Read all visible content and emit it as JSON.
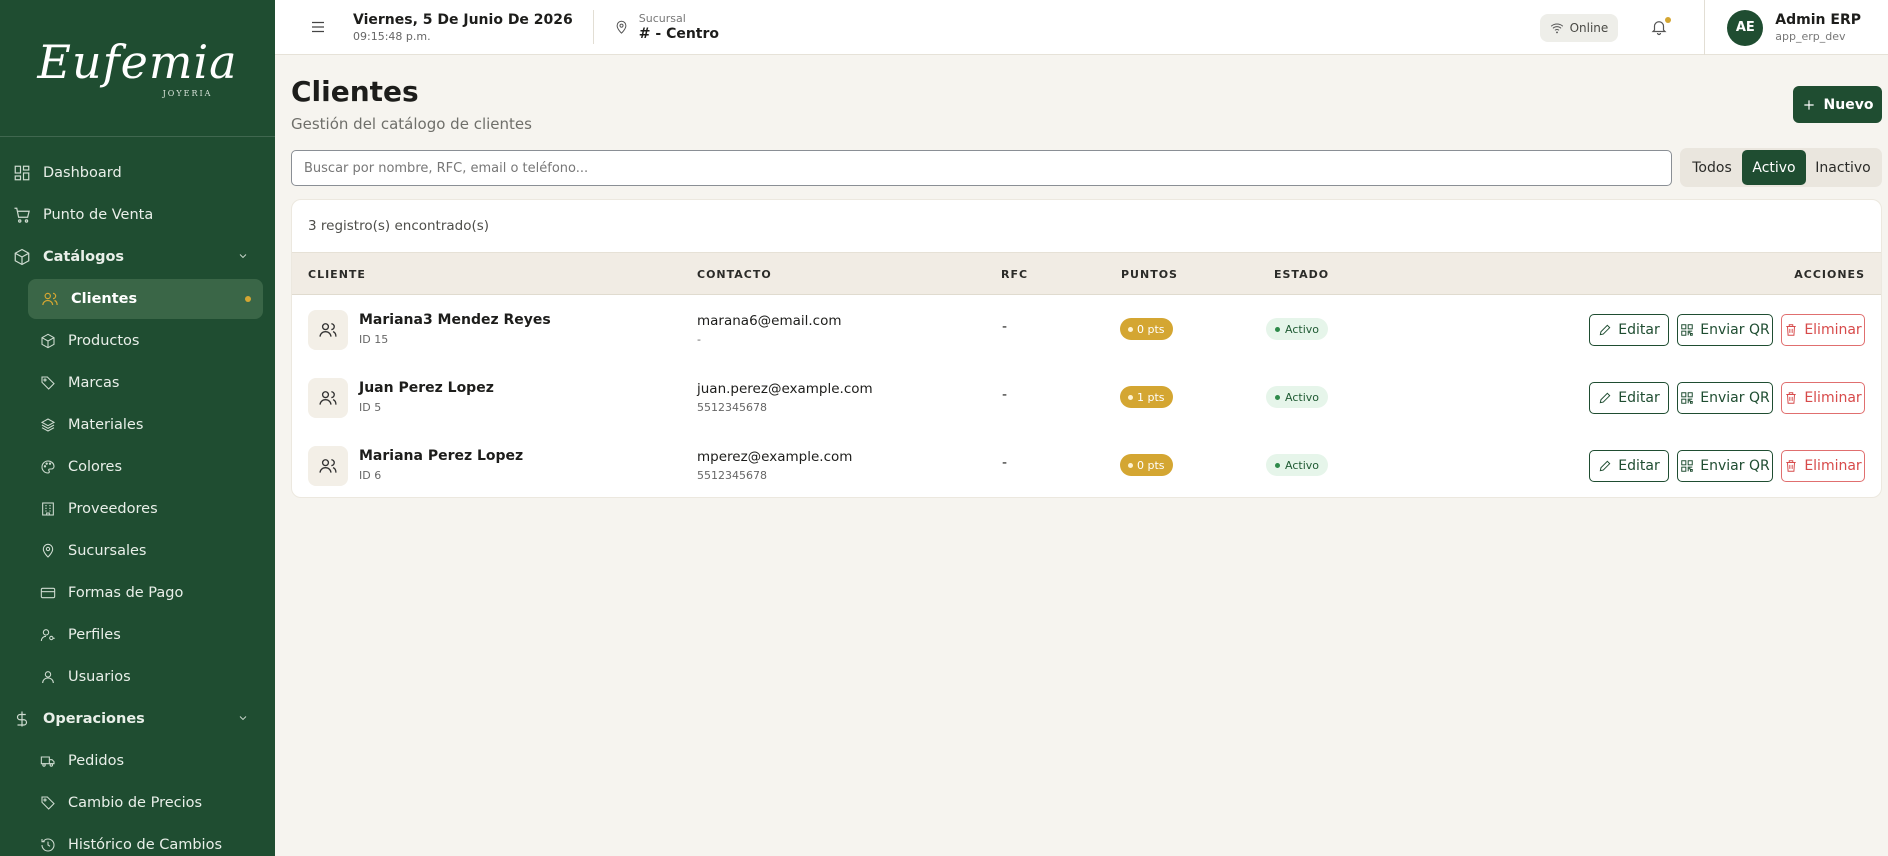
{
  "brand": {
    "name": "Eufemia",
    "subtitle": "JOYERIA"
  },
  "colors": {
    "primary": "#1f4d31",
    "accent": "#d4a632",
    "danger": "#d74a4a",
    "background": "#f6f4ef"
  },
  "sidebar": {
    "items": [
      {
        "label": "Dashboard",
        "icon": "dashboard-icon"
      },
      {
        "label": "Punto de Venta",
        "icon": "cart-icon"
      }
    ],
    "groups": [
      {
        "label": "Catálogos",
        "icon": "box-icon",
        "items": [
          {
            "label": "Clientes",
            "icon": "users-icon",
            "active": true
          },
          {
            "label": "Productos",
            "icon": "box-icon"
          },
          {
            "label": "Marcas",
            "icon": "tag-icon"
          },
          {
            "label": "Materiales",
            "icon": "layers-icon"
          },
          {
            "label": "Colores",
            "icon": "palette-icon"
          },
          {
            "label": "Proveedores",
            "icon": "building-icon"
          },
          {
            "label": "Sucursales",
            "icon": "map-pin-icon"
          },
          {
            "label": "Formas de Pago",
            "icon": "credit-card-icon"
          },
          {
            "label": "Perfiles",
            "icon": "user-key-icon"
          },
          {
            "label": "Usuarios",
            "icon": "user-icon"
          }
        ]
      },
      {
        "label": "Operaciones",
        "icon": "dollar-icon",
        "items": [
          {
            "label": "Pedidos",
            "icon": "truck-icon"
          },
          {
            "label": "Cambio de Precios",
            "icon": "tag-icon"
          },
          {
            "label": "Histórico de Cambios",
            "icon": "history-icon"
          }
        ]
      }
    ]
  },
  "topbar": {
    "date": "Viernes, 5 De Junio De 2026",
    "time": "09:15:48 p.m.",
    "branch_label": "Sucursal",
    "branch_name": "# - Centro",
    "status": "Online",
    "user": {
      "initials": "AE",
      "name": "Admin ERP",
      "username": "app_erp_dev"
    }
  },
  "page": {
    "title": "Clientes",
    "subtitle": "Gestión del catálogo de clientes",
    "new_button": "Nuevo",
    "search_placeholder": "Buscar por nombre, RFC, email o teléfono...",
    "filters": [
      {
        "label": "Todos",
        "active": false
      },
      {
        "label": "Activo",
        "active": true
      },
      {
        "label": "Inactivo",
        "active": false
      }
    ],
    "count_text": "3 registro(s) encontrado(s)"
  },
  "table": {
    "headers": {
      "cliente": "CLIENTE",
      "contacto": "CONTACTO",
      "rfc": "RFC",
      "puntos": "PUNTOS",
      "estado": "ESTADO",
      "acciones": "ACCIONES"
    },
    "actions": {
      "edit": "Editar",
      "qr": "Enviar QR",
      "delete": "Eliminar"
    },
    "rows": [
      {
        "name": "Mariana3 Mendez Reyes",
        "id": "ID 15",
        "email": "marana6@email.com",
        "phone": "-",
        "rfc": "-",
        "points": "0 pts",
        "status": "Activo"
      },
      {
        "name": "Juan Perez Lopez",
        "id": "ID 5",
        "email": "juan.perez@example.com",
        "phone": "5512345678",
        "rfc": "-",
        "points": "1 pts",
        "status": "Activo"
      },
      {
        "name": "Mariana Perez Lopez",
        "id": "ID 6",
        "email": "mperez@example.com",
        "phone": "5512345678",
        "rfc": "-",
        "points": "0 pts",
        "status": "Activo"
      }
    ]
  }
}
